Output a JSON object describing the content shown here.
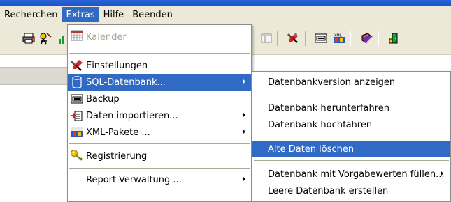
{
  "menubar": {
    "items": [
      {
        "label": "Recherchen"
      },
      {
        "label": "Extras"
      },
      {
        "label": "Hilfe"
      },
      {
        "label": "Beenden"
      }
    ]
  },
  "extras_menu": {
    "items": [
      {
        "label": "Kalender",
        "icon": "calendar-icon",
        "disabled": true
      },
      {
        "label": "Einstellungen",
        "icon": "settings-tools-icon"
      },
      {
        "label": "SQL-Datenbank...",
        "icon": "database-icon",
        "highlighted": true,
        "submenu": true
      },
      {
        "label": "Backup",
        "icon": "backup-icon"
      },
      {
        "label": "Daten importieren...",
        "icon": "import-icon",
        "submenu": true
      },
      {
        "label": "XML-Pakete ...",
        "icon": "xml-icon",
        "submenu": true
      },
      {
        "label": "Registrierung",
        "icon": "key-icon"
      },
      {
        "label": "Report-Verwaltung ...",
        "submenu": true
      }
    ]
  },
  "sql_submenu": {
    "items": [
      {
        "label": "Datenbankversion anzeigen"
      },
      {
        "label": "Datenbank herunterfahren"
      },
      {
        "label": "Datenbank hochfahren"
      },
      {
        "label": "Alte Daten löschen",
        "highlighted": true
      },
      {
        "label": "Datenbank mit Vorgabewerten füllen...",
        "submenu": true
      },
      {
        "label": "Leere Datenbank erstellen"
      }
    ]
  },
  "colors": {
    "highlight": "#316ac5",
    "menubar_bg": "#ece9d8",
    "titlebar": "#2a64d6"
  }
}
